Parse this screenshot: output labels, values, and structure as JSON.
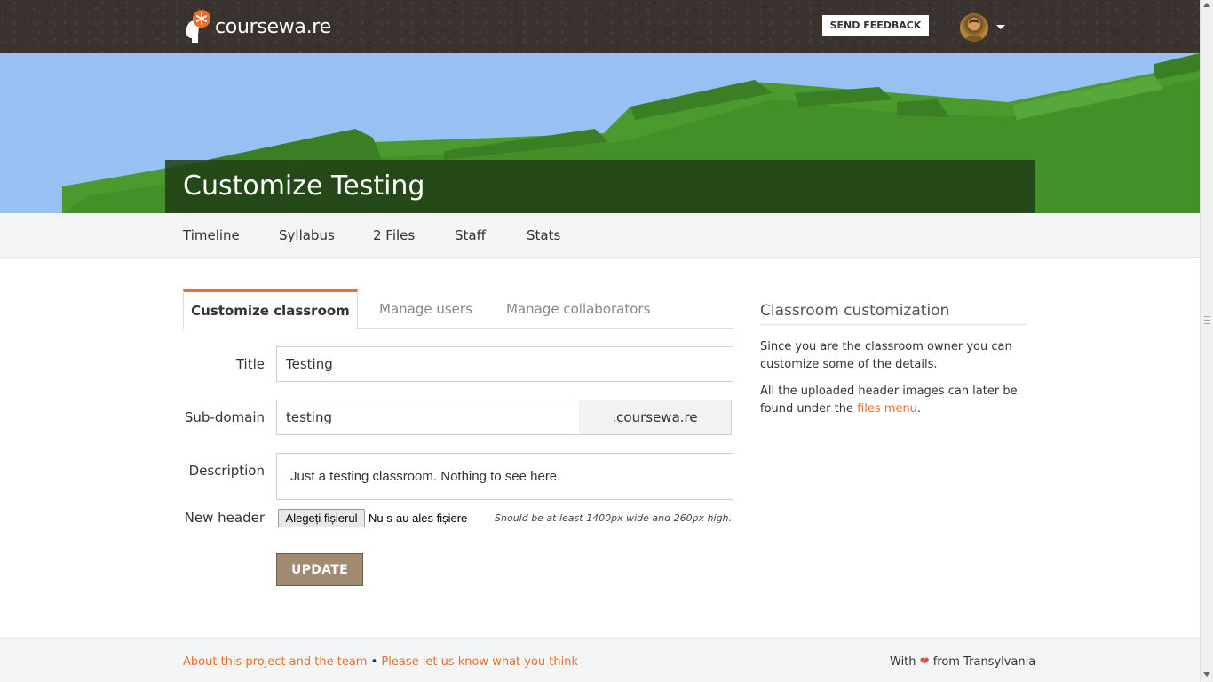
{
  "header": {
    "logo_text": "coursewa.re",
    "feedback_label": "SEND FEEDBACK",
    "avatar_icon": "user-avatar",
    "menu_icon": "caret-down-icon"
  },
  "hero": {
    "title": "Customize Testing"
  },
  "subnav": {
    "items": [
      {
        "label": "Timeline"
      },
      {
        "label": "Syllabus"
      },
      {
        "label": "2 Files"
      },
      {
        "label": "Staff"
      },
      {
        "label": "Stats"
      }
    ]
  },
  "tabs": [
    {
      "label": "Customize classroom",
      "active": true
    },
    {
      "label": "Manage users",
      "active": false
    },
    {
      "label": "Manage collaborators",
      "active": false
    }
  ],
  "form": {
    "title_label": "Title",
    "title_value": "Testing",
    "subdomain_label": "Sub-domain",
    "subdomain_value": "testing",
    "subdomain_suffix": ".coursewa.re",
    "description_label": "Description",
    "description_value": "Just a testing classroom. Nothing to see here.",
    "header_label": "New header",
    "file_button": "Alegeți fișierul",
    "file_status": "Nu s-au ales fișiere",
    "file_hint": "Should be at least 1400px wide and 260px high.",
    "update_label": "UPDATE"
  },
  "sidebar": {
    "title": "Classroom customization",
    "para1": "Since you are the classroom owner you can customize some of the details.",
    "para2_before": "All the uploaded header images can later be found under the ",
    "para2_link": "files menu",
    "para2_after": "."
  },
  "footer": {
    "link1": "About this project and the team",
    "separator": " • ",
    "link2": "Please let us know what you think",
    "with": "With",
    "from": "from Transylvania"
  },
  "colors": {
    "accent": "#e8702a",
    "navbar": "#3a322f",
    "sky": "#98c0f3",
    "grass": "#4a9a2e",
    "update_button": "#a08a72"
  }
}
